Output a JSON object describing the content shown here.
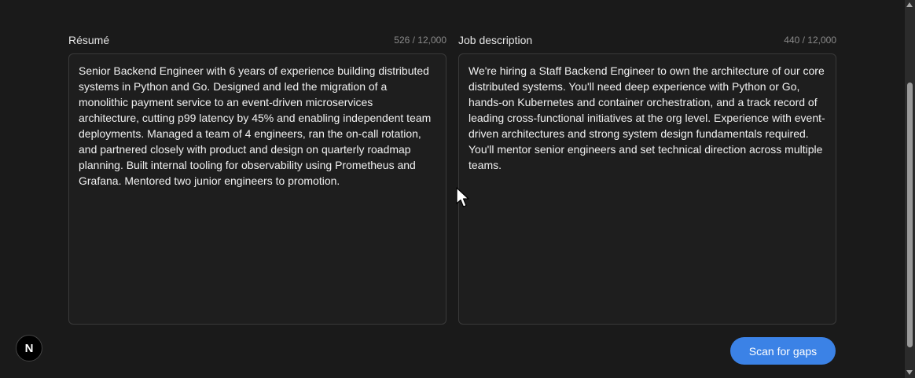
{
  "resume": {
    "label": "Résumé",
    "count": "526 / 12,000",
    "text": "Senior Backend Engineer with 6 years of experience building distributed systems in Python and Go. Designed and led the migration of a monolithic payment service to an event-driven microservices architecture, cutting p99 latency by 45% and enabling independent team deployments. Managed a team of 4 engineers, ran the on-call rotation, and partnered closely with product and design on quarterly roadmap planning. Built internal tooling for observability using Prometheus and Grafana. Mentored two junior engineers to promotion."
  },
  "job": {
    "label": "Job description",
    "count": "440 / 12,000",
    "text": "We're hiring a Staff Backend Engineer to own the architecture of our core distributed systems. You'll need deep experience with Python or Go, hands-on Kubernetes and container orchestration, and a track record of leading cross-functional initiatives at the org level. Experience with event-driven architectures and strong system design fundamentals required. You'll mentor senior engineers and set technical direction across multiple teams."
  },
  "actions": {
    "scan_label": "Scan for gaps"
  },
  "badge": {
    "letter": "N"
  },
  "colors": {
    "background": "#1a1a1a",
    "accent": "#3b82e6"
  }
}
